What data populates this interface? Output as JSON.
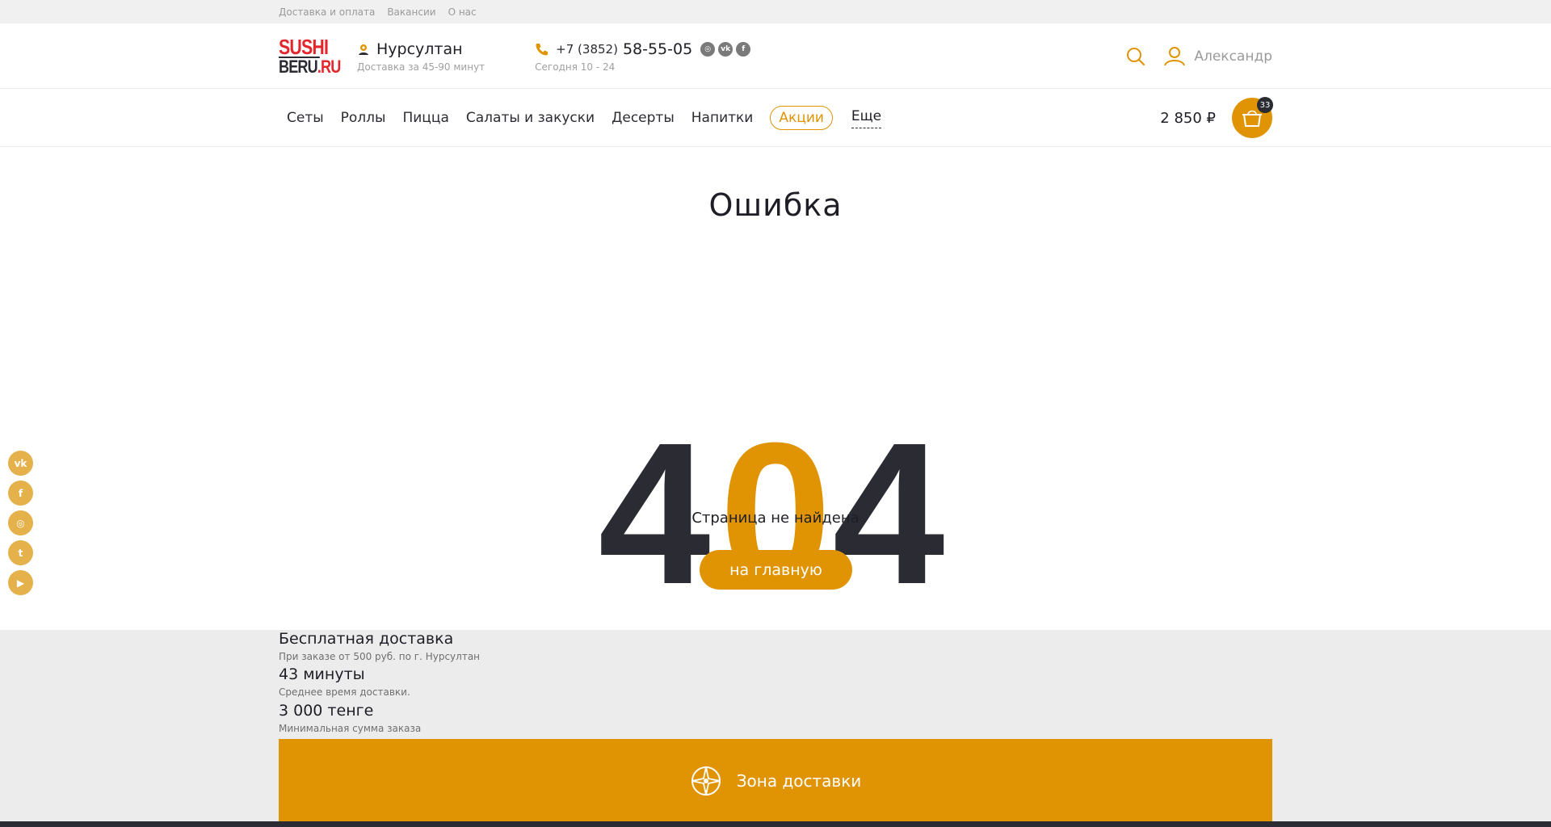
{
  "topbar": {
    "links": [
      "Доставка и оплата",
      "Вакансии",
      "О нас"
    ]
  },
  "header": {
    "logo_line1": "SUSHI",
    "logo_line2a": "BERU",
    "logo_line2b": ".RU",
    "city": "Нурсултан",
    "delivery_time": "Доставка за 45-90 минут",
    "phone_code": "+7 (3852)",
    "phone_number": "58-55-05",
    "hours": "Сегодня 10 - 24",
    "mini_socials": [
      "instagram-icon",
      "vk-icon",
      "fb-icon"
    ],
    "user_name": "Александр"
  },
  "nav": {
    "items": [
      "Сеты",
      "Роллы",
      "Пицца",
      "Салаты и закуски",
      "Десерты",
      "Напитки"
    ],
    "promo": "Акции",
    "more": "Еще",
    "cart_sum": "2 850 ₽",
    "cart_count": "33"
  },
  "main": {
    "title": "Ошибка",
    "code_left": "4",
    "code_mid": "0",
    "code_right": "4",
    "message": "Страница не найдена",
    "home_button": "на главную"
  },
  "side_socials": [
    "vk",
    "f",
    "ig",
    "tw",
    "yt"
  ],
  "info": {
    "items": [
      {
        "title": "Бесплатная доставка",
        "sub": "При заказе от 500 руб. по г. Нурсултан"
      },
      {
        "title": "43 минуты",
        "sub": "Среднее время доставки."
      },
      {
        "title": "3 000 тенге",
        "sub": "Минимальная сумма заказа"
      }
    ],
    "zone_label": "Зона доставки"
  },
  "colors": {
    "accent": "#e09404",
    "dark": "#2b2b33",
    "brand_red": "#e3262c"
  }
}
